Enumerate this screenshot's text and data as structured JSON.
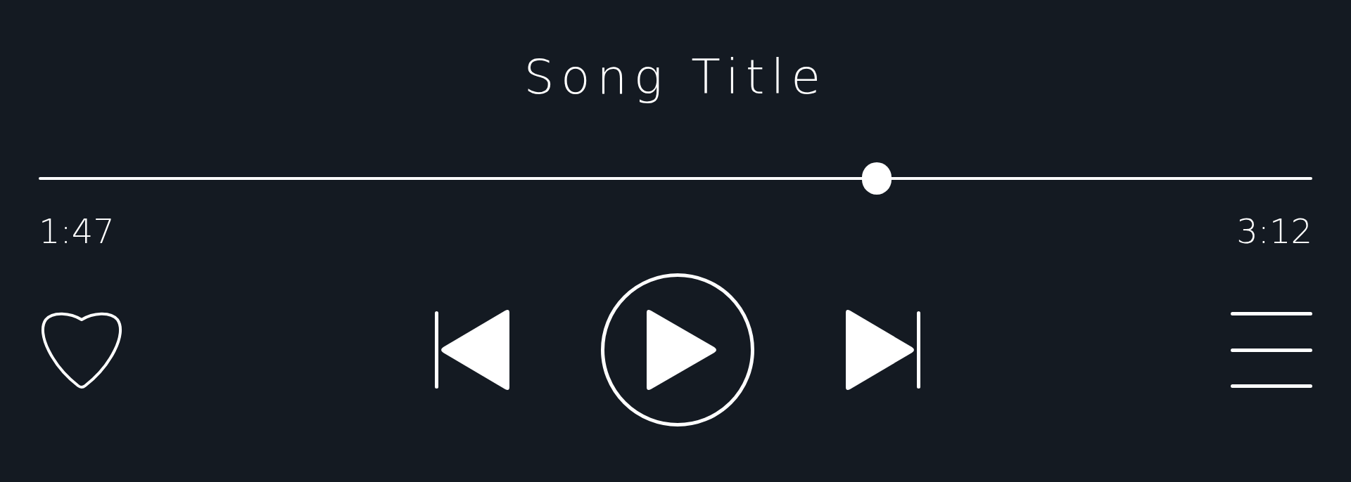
{
  "song": {
    "title": "Song Title"
  },
  "progress": {
    "level": 0.658,
    "elapsed": "1:47",
    "duration": "3:12"
  },
  "controls": {
    "liked": false,
    "playing": false
  }
}
